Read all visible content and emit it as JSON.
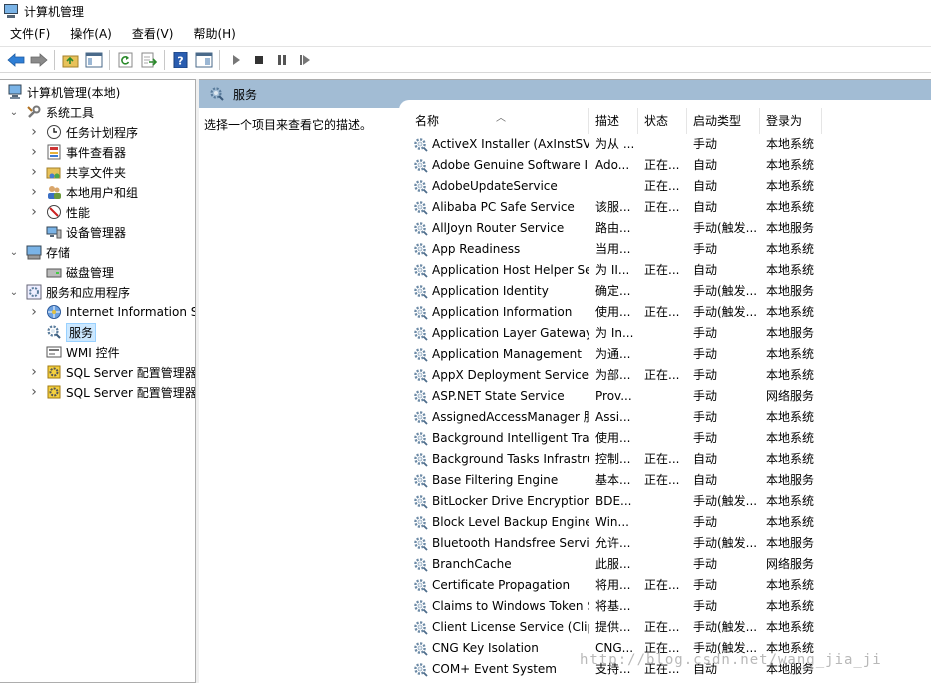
{
  "window": {
    "title": "计算机管理"
  },
  "menu": [
    "文件(F)",
    "操作(A)",
    "查看(V)",
    "帮助(H)"
  ],
  "toolbar": {
    "buttons": [
      "back-icon",
      "forward-icon",
      "up-folder-icon",
      "show-hide-tree-icon",
      "refresh-icon",
      "export-list-icon",
      "help-icon",
      "properties-icon",
      "play-icon",
      "stop-icon",
      "pause-icon",
      "restart-icon"
    ]
  },
  "tree": {
    "root": "计算机管理(本地)",
    "items": [
      {
        "label": "系统工具",
        "level": 1,
        "expander": "open",
        "icon": "tools-icon"
      },
      {
        "label": "任务计划程序",
        "level": 2,
        "expander": "closed",
        "icon": "clock-icon"
      },
      {
        "label": "事件查看器",
        "level": 2,
        "expander": "closed",
        "icon": "event-viewer-icon"
      },
      {
        "label": "共享文件夹",
        "level": 2,
        "expander": "closed",
        "icon": "shared-folder-icon"
      },
      {
        "label": "本地用户和组",
        "level": 2,
        "expander": "closed",
        "icon": "users-icon"
      },
      {
        "label": "性能",
        "level": 2,
        "expander": "closed",
        "icon": "performance-icon"
      },
      {
        "label": "设备管理器",
        "level": 2,
        "expander": "none",
        "icon": "device-manager-icon"
      },
      {
        "label": "存储",
        "level": 1,
        "expander": "open",
        "icon": "storage-icon"
      },
      {
        "label": "磁盘管理",
        "level": 2,
        "expander": "none",
        "icon": "disk-icon"
      },
      {
        "label": "服务和应用程序",
        "level": 1,
        "expander": "open",
        "icon": "services-apps-icon"
      },
      {
        "label": "Internet Information Services",
        "level": 2,
        "expander": "closed",
        "icon": "iis-icon"
      },
      {
        "label": "服务",
        "level": 2,
        "expander": "none",
        "icon": "services-icon",
        "selected": true
      },
      {
        "label": "WMI 控件",
        "level": 2,
        "expander": "none",
        "icon": "wmi-icon"
      },
      {
        "label": "SQL Server 配置管理器",
        "level": 2,
        "expander": "closed",
        "icon": "sql-icon"
      },
      {
        "label": "SQL Server 配置管理器",
        "level": 2,
        "expander": "closed",
        "icon": "sql-icon"
      }
    ]
  },
  "panel": {
    "title": "服务",
    "description": "选择一个项目来查看它的描述。"
  },
  "columns": [
    "名称",
    "描述",
    "状态",
    "启动类型",
    "登录为"
  ],
  "services": [
    {
      "name": "ActiveX Installer (AxInstSV)",
      "desc": "为从 ...",
      "status": "",
      "startup": "手动",
      "logon": "本地系统"
    },
    {
      "name": "Adobe Genuine Software Integrity Service",
      "desc": "Ado...",
      "status": "正在...",
      "startup": "自动",
      "logon": "本地系统"
    },
    {
      "name": "AdobeUpdateService",
      "desc": "",
      "status": "正在...",
      "startup": "自动",
      "logon": "本地系统"
    },
    {
      "name": "Alibaba PC Safe Service",
      "desc": "该服...",
      "status": "正在...",
      "startup": "自动",
      "logon": "本地系统"
    },
    {
      "name": "AllJoyn Router Service",
      "desc": "路由...",
      "status": "",
      "startup": "手动(触发...",
      "logon": "本地服务"
    },
    {
      "name": "App Readiness",
      "desc": "当用...",
      "status": "",
      "startup": "手动",
      "logon": "本地系统"
    },
    {
      "name": "Application Host Helper Service",
      "desc": "为 II...",
      "status": "正在...",
      "startup": "自动",
      "logon": "本地系统"
    },
    {
      "name": "Application Identity",
      "desc": "确定...",
      "status": "",
      "startup": "手动(触发...",
      "logon": "本地服务"
    },
    {
      "name": "Application Information",
      "desc": "使用...",
      "status": "正在...",
      "startup": "手动(触发...",
      "logon": "本地系统"
    },
    {
      "name": "Application Layer Gateway Service",
      "desc": "为 In...",
      "status": "",
      "startup": "手动",
      "logon": "本地服务"
    },
    {
      "name": "Application Management",
      "desc": "为通...",
      "status": "",
      "startup": "手动",
      "logon": "本地系统"
    },
    {
      "name": "AppX Deployment Service (AppXSVC)",
      "desc": "为部...",
      "status": "正在...",
      "startup": "手动",
      "logon": "本地系统"
    },
    {
      "name": "ASP.NET State Service",
      "desc": "Prov...",
      "status": "",
      "startup": "手动",
      "logon": "网络服务"
    },
    {
      "name": "AssignedAccessManager 服务",
      "desc": "Assi...",
      "status": "",
      "startup": "手动",
      "logon": "本地系统"
    },
    {
      "name": "Background Intelligent Transfer Service",
      "desc": "使用...",
      "status": "",
      "startup": "手动",
      "logon": "本地系统"
    },
    {
      "name": "Background Tasks Infrastructure Service",
      "desc": "控制...",
      "status": "正在...",
      "startup": "自动",
      "logon": "本地系统"
    },
    {
      "name": "Base Filtering Engine",
      "desc": "基本...",
      "status": "正在...",
      "startup": "自动",
      "logon": "本地服务"
    },
    {
      "name": "BitLocker Drive Encryption Service",
      "desc": "BDE...",
      "status": "",
      "startup": "手动(触发...",
      "logon": "本地系统"
    },
    {
      "name": "Block Level Backup Engine Service",
      "desc": "Win...",
      "status": "",
      "startup": "手动",
      "logon": "本地系统"
    },
    {
      "name": "Bluetooth Handsfree Service",
      "desc": "允许...",
      "status": "",
      "startup": "手动(触发...",
      "logon": "本地服务"
    },
    {
      "name": "BranchCache",
      "desc": "此服...",
      "status": "",
      "startup": "手动",
      "logon": "网络服务"
    },
    {
      "name": "Certificate Propagation",
      "desc": "将用...",
      "status": "正在...",
      "startup": "手动",
      "logon": "本地系统"
    },
    {
      "name": "Claims to Windows Token Service",
      "desc": "将基...",
      "status": "",
      "startup": "手动",
      "logon": "本地系统"
    },
    {
      "name": "Client License Service (ClipSVC)",
      "desc": "提供...",
      "status": "正在...",
      "startup": "手动(触发...",
      "logon": "本地系统"
    },
    {
      "name": "CNG Key Isolation",
      "desc": "CNG...",
      "status": "正在...",
      "startup": "手动(触发...",
      "logon": "本地系统"
    },
    {
      "name": "COM+ Event System",
      "desc": "支持...",
      "status": "正在...",
      "startup": "自动",
      "logon": "本地服务"
    }
  ],
  "watermark": "http://blog.csdn.net/wang_jia_ji"
}
